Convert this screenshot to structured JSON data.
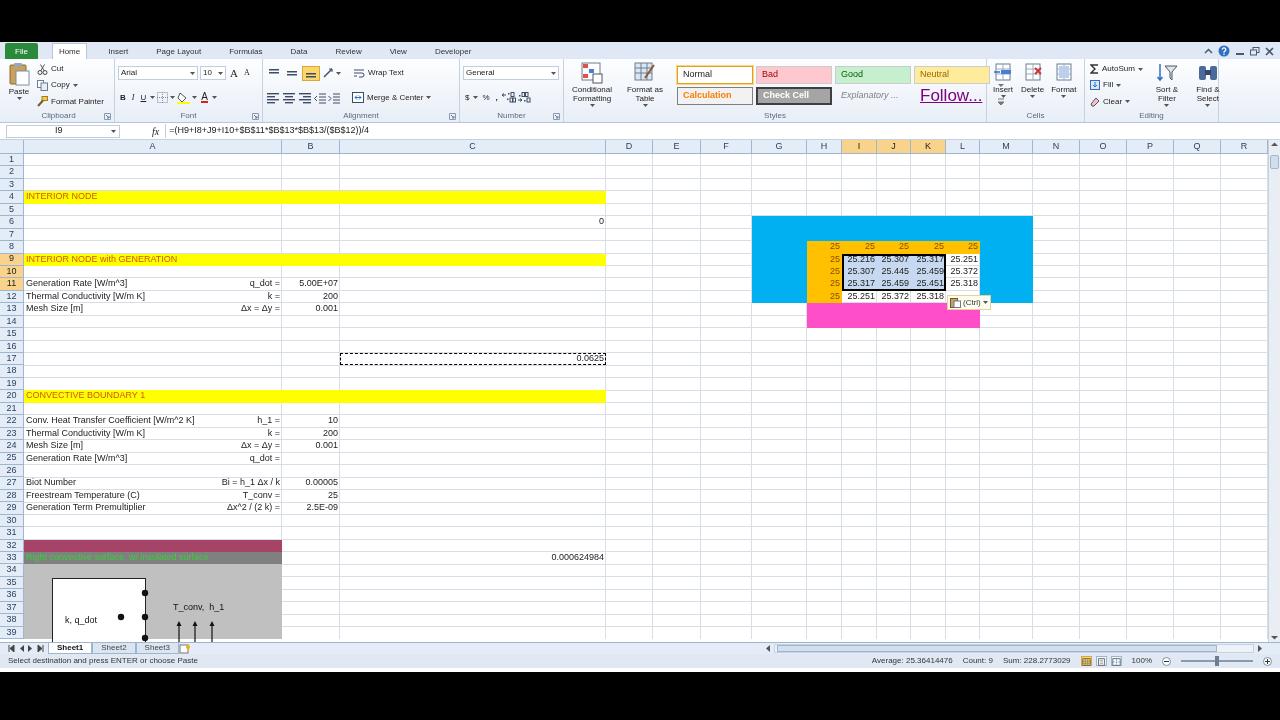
{
  "ribbon_tabs": [
    {
      "label": "File",
      "kind": "file",
      "selected": false
    },
    {
      "label": "Home",
      "kind": "tab",
      "selected": true
    },
    {
      "label": "Insert",
      "kind": "tab",
      "selected": false
    },
    {
      "label": "Page Layout",
      "kind": "tab",
      "selected": false
    },
    {
      "label": "Formulas",
      "kind": "tab",
      "selected": false
    },
    {
      "label": "Data",
      "kind": "tab",
      "selected": false
    },
    {
      "label": "Review",
      "kind": "tab",
      "selected": false
    },
    {
      "label": "View",
      "kind": "tab",
      "selected": false
    },
    {
      "label": "Developer",
      "kind": "tab",
      "selected": false
    }
  ],
  "ribbon": {
    "clipboard": {
      "label": "Clipboard",
      "paste": "Paste",
      "cut": "Cut",
      "copy": "Copy",
      "format_painter": "Format Painter"
    },
    "font": {
      "label": "Font",
      "face": "Arial",
      "size": "10",
      "grow": "A",
      "shrink": "A",
      "bold": "B",
      "italic": "I",
      "underline": "U",
      "font_color": "A"
    },
    "alignment": {
      "label": "Alignment",
      "vertical": [
        {
          "selected": false
        },
        {
          "selected": false
        },
        {
          "selected": true
        }
      ],
      "wrap": "Wrap Text",
      "merge": "Merge & Center"
    },
    "number": {
      "label": "Number",
      "format": "General",
      "currency": "$",
      "percent": "%",
      "comma": ","
    },
    "styles": {
      "label": "Styles",
      "conditional": "Conditional Formatting",
      "table": "Format as Table",
      "gallery": [
        {
          "label": "Normal",
          "kind": "normal",
          "selected": true
        },
        {
          "label": "Bad",
          "kind": "bad",
          "selected": false
        },
        {
          "label": "Good",
          "kind": "good",
          "selected": false
        },
        {
          "label": "Neutral",
          "kind": "neutral",
          "selected": false
        },
        {
          "label": "Calculation",
          "kind": "calculation",
          "selected": false
        },
        {
          "label": "Check Cell",
          "kind": "check",
          "selected": false
        },
        {
          "label": "Explanatory ...",
          "kind": "explanatory",
          "selected": false
        },
        {
          "label": "Follow...",
          "kind": "hyperlink",
          "selected": false
        }
      ]
    },
    "cells": {
      "label": "Cells",
      "insert": "Insert",
      "delete": "Delete",
      "format": "Format"
    },
    "editing": {
      "label": "Editing",
      "autosum": "AutoSum",
      "fill": "Fill",
      "clear": "Clear",
      "sort": "Sort & Filter",
      "find": "Find & Select"
    }
  },
  "formula_bar": {
    "name_box": "I9",
    "fx": "fx",
    "formula": "=(H9+I8+J9+I10+$B$11*$B$13*$B$13/($B$12))/4"
  },
  "sheet": {
    "columns": [
      {
        "label": "A",
        "selected": false
      },
      {
        "label": "B",
        "selected": false
      },
      {
        "label": "C",
        "selected": false
      },
      {
        "label": "D",
        "selected": false
      },
      {
        "label": "E",
        "selected": false
      },
      {
        "label": "F",
        "selected": false
      },
      {
        "label": "G",
        "selected": false
      },
      {
        "label": "H",
        "selected": false
      },
      {
        "label": "I",
        "selected": true
      },
      {
        "label": "J",
        "selected": true
      },
      {
        "label": "K",
        "selected": true
      },
      {
        "label": "L",
        "selected": false
      },
      {
        "label": "M",
        "selected": false
      },
      {
        "label": "N",
        "selected": false
      },
      {
        "label": "O",
        "selected": false
      },
      {
        "label": "P",
        "selected": false
      },
      {
        "label": "Q",
        "selected": false
      },
      {
        "label": "R",
        "selected": false
      }
    ],
    "rows": [
      {
        "label": "1",
        "kind": "plain",
        "selected": false
      },
      {
        "label": "2",
        "kind": "plain",
        "selected": false
      },
      {
        "label": "3",
        "kind": "plain",
        "selected": false
      },
      {
        "label": "4",
        "kind": "heading",
        "selected": false,
        "cells": {
          "A": "INTERIOR NODE"
        }
      },
      {
        "label": "5",
        "kind": "plain",
        "selected": false
      },
      {
        "label": "6",
        "kind": "plain",
        "selected": false,
        "cells": {
          "C": "0",
          "G": {
            "color": "#00b0f0"
          },
          "H": {
            "color": "#00b0f0"
          },
          "I": {
            "color": "#00b0f0"
          },
          "J": {
            "color": "#00b0f0"
          },
          "K": {
            "color": "#00b0f0"
          },
          "L": {
            "color": "#00b0f0"
          },
          "M": {
            "color": "#00b0f0"
          }
        }
      },
      {
        "label": "7",
        "kind": "plain",
        "selected": false,
        "cells": {
          "G": {
            "color": "#00b0f0"
          },
          "H": {
            "color": "#00b0f0"
          },
          "I": {
            "color": "#00b0f0"
          },
          "J": {
            "color": "#00b0f0"
          },
          "K": {
            "color": "#00b0f0"
          },
          "L": {
            "color": "#00b0f0"
          },
          "M": {
            "color": "#00b0f0"
          }
        }
      },
      {
        "label": "8",
        "kind": "plain",
        "selected": false,
        "cells": {
          "G": {
            "color": "#00b0f0"
          },
          "H": {
            "text": "25",
            "color": "#ffc000",
            "selected": false
          },
          "I": {
            "text": "25",
            "color": "#ffc000",
            "selected": false
          },
          "J": {
            "text": "25",
            "color": "#ffc000",
            "selected": false
          },
          "K": {
            "text": "25",
            "color": "#ffc000",
            "selected": false
          },
          "L": {
            "text": "25",
            "color": "#ffc000",
            "selected": false
          },
          "M": {
            "color": "#00b0f0"
          }
        }
      },
      {
        "label": "9",
        "kind": "heading",
        "selected": true,
        "cells": {
          "A": "INTERIOR NODE with GENERATION",
          "G": {
            "color": "#00b0f0"
          },
          "H": {
            "text": "25",
            "color": "#ffc000",
            "selected": false
          },
          "I": {
            "text": "25.216",
            "selected": true
          },
          "J": {
            "text": "25.307",
            "selected": true
          },
          "K": {
            "text": "25.317",
            "selected": true
          },
          "L": {
            "text": "25.251",
            "selected": false
          },
          "M": {
            "color": "#00b0f0"
          }
        }
      },
      {
        "label": "10",
        "kind": "plain",
        "selected": true,
        "cells": {
          "G": {
            "color": "#00b0f0"
          },
          "H": {
            "text": "25",
            "color": "#ffc000",
            "selected": false
          },
          "I": {
            "text": "25.307",
            "selected": true
          },
          "J": {
            "text": "25.445",
            "selected": true
          },
          "K": {
            "text": "25.459",
            "selected": true
          },
          "L": {
            "text": "25.372",
            "selected": false
          },
          "M": {
            "color": "#00b0f0"
          }
        }
      },
      {
        "label": "11",
        "kind": "plain",
        "selected": true,
        "symbol": "q_dot =",
        "cells": {
          "A": "Generation Rate [W/m^3]",
          "B": "5.00E+07",
          "G": {
            "color": "#00b0f0"
          },
          "H": {
            "text": "25",
            "color": "#ffc000",
            "selected": false
          },
          "I": {
            "text": "25.317",
            "selected": true
          },
          "J": {
            "text": "25.459",
            "selected": true
          },
          "K": {
            "text": "25.451",
            "selected": true
          },
          "L": {
            "text": "25.318",
            "selected": false
          },
          "M": {
            "color": "#00b0f0"
          }
        }
      },
      {
        "label": "12",
        "kind": "plain",
        "selected": false,
        "symbol": "k =",
        "cells": {
          "A": "Thermal Conductivity [W/m K]",
          "B": "200",
          "G": {
            "color": "#00b0f0"
          },
          "H": {
            "text": "25",
            "color": "#ffc000",
            "selected": false
          },
          "I": {
            "text": "25.251",
            "selected": false
          },
          "J": {
            "text": "25.372",
            "selected": false
          },
          "K": {
            "text": "25.318",
            "selected": false
          },
          "M": {
            "color": "#00b0f0"
          }
        }
      },
      {
        "label": "13",
        "kind": "plain",
        "selected": false,
        "symbol": "Δx = Δy =",
        "cells": {
          "A": "Mesh Size [m]",
          "B": "0.001",
          "H": {
            "color": "#ff4fc8"
          },
          "I": {
            "color": "#ff4fc8"
          },
          "J": {
            "color": "#ff4fc8"
          },
          "K": {
            "color": "#ff4fc8"
          },
          "L": {
            "color": "#ff4fc8"
          }
        }
      },
      {
        "label": "14",
        "kind": "plain",
        "selected": false,
        "cells": {
          "H": {
            "color": "#ff4fc8"
          },
          "I": {
            "color": "#ff4fc8"
          },
          "J": {
            "color": "#ff4fc8"
          },
          "K": {
            "color": "#ff4fc8"
          },
          "L": {
            "color": "#ff4fc8"
          }
        }
      },
      {
        "label": "15",
        "kind": "plain",
        "selected": false
      },
      {
        "label": "16",
        "kind": "plain",
        "selected": false
      },
      {
        "label": "17",
        "kind": "plain",
        "selected": false,
        "cells": {
          "C": {
            "text": "0.0625",
            "marquee": true
          }
        }
      },
      {
        "label": "18",
        "kind": "plain",
        "selected": false
      },
      {
        "label": "19",
        "kind": "plain",
        "selected": false
      },
      {
        "label": "20",
        "kind": "heading",
        "selected": false,
        "cells": {
          "A": "CONVECTIVE BOUNDARY 1"
        }
      },
      {
        "label": "21",
        "kind": "plain",
        "selected": false
      },
      {
        "label": "22",
        "kind": "plain",
        "selected": false,
        "symbol": "h_1 =",
        "cells": {
          "A": "Conv. Heat Transfer Coefficient [W/m^2 K]",
          "B": "10"
        }
      },
      {
        "label": "23",
        "kind": "plain",
        "selected": false,
        "symbol": "k =",
        "cells": {
          "A": "Thermal Conductivity [W/m K]",
          "B": "200"
        }
      },
      {
        "label": "24",
        "kind": "plain",
        "selected": false,
        "symbol": "Δx = Δy =",
        "cells": {
          "A": "Mesh Size [m]",
          "B": "0.001"
        }
      },
      {
        "label": "25",
        "kind": "plain",
        "selected": false,
        "symbol": "q_dot =",
        "cells": {
          "A": "Generation Rate [W/m^3]"
        }
      },
      {
        "label": "26",
        "kind": "plain",
        "selected": false
      },
      {
        "label": "27",
        "kind": "plain",
        "selected": false,
        "symbol": "Bi = h_1 Δx / k",
        "cells": {
          "A": "Biot Number",
          "B": "0.00005"
        }
      },
      {
        "label": "28",
        "kind": "plain",
        "selected": false,
        "symbol": "T_conv =",
        "cells": {
          "A": "Freestream Temperature (C)",
          "B": "25"
        }
      },
      {
        "label": "29",
        "kind": "plain",
        "selected": false,
        "symbol": "Δx^2 / (2 k) =",
        "cells": {
          "A": "Generation Term Premultiplier",
          "B": "2.5E-09"
        }
      },
      {
        "label": "30",
        "kind": "plain",
        "selected": false
      },
      {
        "label": "31",
        "kind": "plain",
        "selected": false
      },
      {
        "label": "32",
        "kind": "plain",
        "selected": false,
        "cells": {
          "A": {
            "color": "#a64468"
          }
        }
      },
      {
        "label": "33",
        "kind": "caption",
        "selected": false,
        "cells": {
          "A": "Right convective surface, w/ insulated surface",
          "C": "0.000624984"
        }
      },
      {
        "label": "34",
        "kind": "plain",
        "selected": false,
        "cells": {
          "A": {
            "color": "#c0c0c0"
          }
        }
      },
      {
        "label": "35",
        "kind": "plain",
        "selected": false,
        "cells": {
          "A": {
            "color": "#c0c0c0"
          }
        }
      },
      {
        "label": "36",
        "kind": "plain",
        "selected": false,
        "cells": {
          "A": {
            "color": "#c0c0c0"
          }
        }
      },
      {
        "label": "37",
        "kind": "plain",
        "selected": false,
        "cells": {
          "A": {
            "color": "#c0c0c0"
          }
        }
      },
      {
        "label": "38",
        "kind": "plain",
        "selected": false,
        "cells": {
          "A": {
            "color": "#c0c0c0"
          }
        }
      },
      {
        "label": "39",
        "kind": "plain",
        "selected": false,
        "cells": {
          "A": {
            "color": "#c0c0c0"
          }
        }
      }
    ],
    "paste_options": {
      "label": "(Ctrl)"
    },
    "diagram": {
      "body_label": "k, q_dot",
      "boundary_label": "T_conv,  h_1"
    }
  },
  "sheet_tabs": [
    {
      "label": "Sheet1",
      "selected": true
    },
    {
      "label": "Sheet2",
      "selected": false
    },
    {
      "label": "Sheet3",
      "selected": false
    }
  ],
  "status_bar": {
    "message": "Select destination and press ENTER or choose Paste",
    "average": "Average: 25.36414476",
    "count": "Count: 9",
    "sum": "Sum: 228.2773029",
    "views": [
      {
        "kind": "normal",
        "selected": true
      },
      {
        "kind": "layout",
        "selected": false
      },
      {
        "kind": "break",
        "selected": false
      }
    ],
    "zoom": {
      "text": "100%",
      "level": 0.5
    }
  }
}
